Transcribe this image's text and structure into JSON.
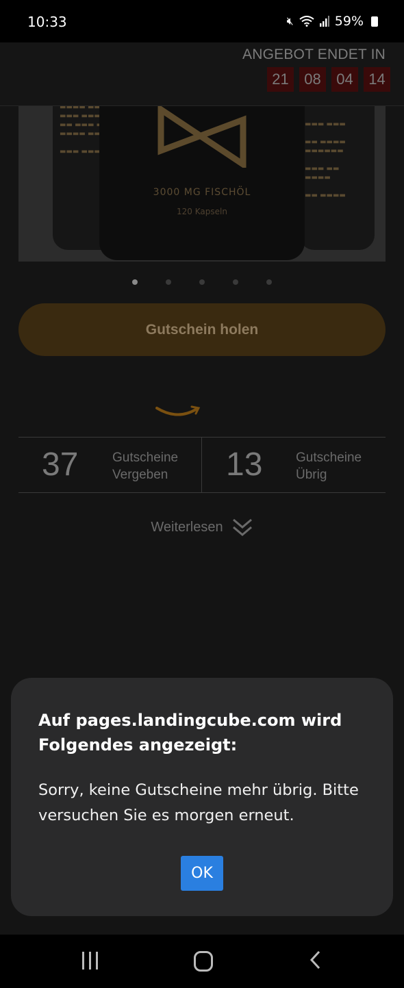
{
  "status_bar": {
    "time": "10:33",
    "battery": "59%",
    "icons": [
      "mute-icon",
      "wifi-icon",
      "signal-icon",
      "battery-icon"
    ]
  },
  "header": {
    "offer_label": "ANGEBOT ENDET IN",
    "countdown": [
      "21",
      "08",
      "04",
      "14"
    ]
  },
  "product": {
    "label_title": "3000 MG FISCHÖL",
    "label_subtitle": "120 Kapseln",
    "carousel_count": 5,
    "carousel_active": 0
  },
  "coupon_button": {
    "label": "Gutschein holen"
  },
  "stats": {
    "given": {
      "value": "37",
      "line1": "Gutscheine",
      "line2": "Vergeben"
    },
    "left": {
      "value": "13",
      "line1": "Gutscheine",
      "line2": "Übrig"
    }
  },
  "read_more": {
    "label": "Weiterlesen"
  },
  "dialog": {
    "title": "Auf pages.landingcube.com wird Folgendes angezeigt:",
    "message": "Sorry, keine Gutscheine mehr übrig. Bitte versuchen Sie es morgen erneut.",
    "ok_label": "OK"
  },
  "colors": {
    "accent_button": "#3a2a10",
    "dialog_ok": "#2a7fe0",
    "countdown_box": "#3a0a0a"
  }
}
